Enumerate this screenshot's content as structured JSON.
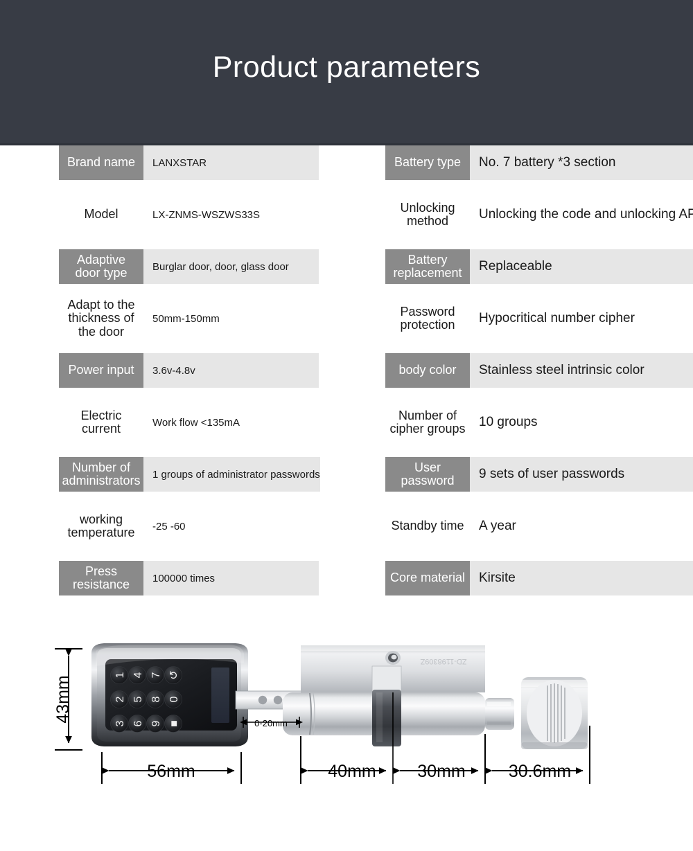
{
  "header": {
    "title": "Product parameters"
  },
  "specs": {
    "left": [
      {
        "label": "Brand name",
        "value": "LANXSTAR",
        "shaded": true
      },
      {
        "label": "Model",
        "value": "LX-ZNMS-WSZWS33S",
        "shaded": false
      },
      {
        "label": "Adaptive door type",
        "value": "Burglar door, door, glass door",
        "shaded": true
      },
      {
        "label": "Adapt to the thickness of the door",
        "value": "50mm-150mm",
        "shaded": false
      },
      {
        "label": "Power input",
        "value": "3.6v-4.8v",
        "shaded": true
      },
      {
        "label": "Electric current",
        "value": "Work flow <135mA",
        "shaded": false
      },
      {
        "label": "Number of administrators",
        "value": "1 groups of administrator passwords",
        "shaded": true
      },
      {
        "label": "working temperature",
        "value": "-25 -60",
        "shaded": false
      },
      {
        "label": "Press resistance",
        "value": "100000 times",
        "shaded": true
      }
    ],
    "right": [
      {
        "label": "Battery type",
        "value": "No. 7 battery *3 section",
        "shaded": true
      },
      {
        "label": "Unlocking method",
        "value": "Unlocking the code and unlocking APP",
        "shaded": false
      },
      {
        "label": "Battery replacement",
        "value": "Replaceable",
        "shaded": true
      },
      {
        "label": "Password protection",
        "value": "Hypocritical number cipher",
        "shaded": false
      },
      {
        "label": "body color",
        "value": "Stainless steel intrinsic color",
        "shaded": true
      },
      {
        "label": "Number of cipher groups",
        "value": "10 groups",
        "shaded": false
      },
      {
        "label": "User password",
        "value": "9 sets of user passwords",
        "shaded": true
      },
      {
        "label": "Standby time",
        "value": "A year",
        "shaded": false
      },
      {
        "label": "Core material",
        "value": "Kirsite",
        "shaded": true
      }
    ]
  },
  "diagram": {
    "dimensions": {
      "height": "43mm",
      "keypad_width": "56mm",
      "gap": "0-20mm",
      "cylinder_front": "40mm",
      "cylinder_mid": "30mm",
      "knob": "30.6mm"
    },
    "keypad": {
      "columns": [
        [
          "↺",
          "7",
          "4",
          "1"
        ],
        [
          "0",
          "8",
          "5",
          "2"
        ],
        [
          "■",
          "9",
          "6",
          "3"
        ]
      ]
    }
  },
  "colors": {
    "banner_bg": "#383c45",
    "label_bg": "#8a8a8a",
    "value_bg": "#e6e6e6",
    "text_dark": "#1a1a1a",
    "text_light": "#ffffff"
  }
}
